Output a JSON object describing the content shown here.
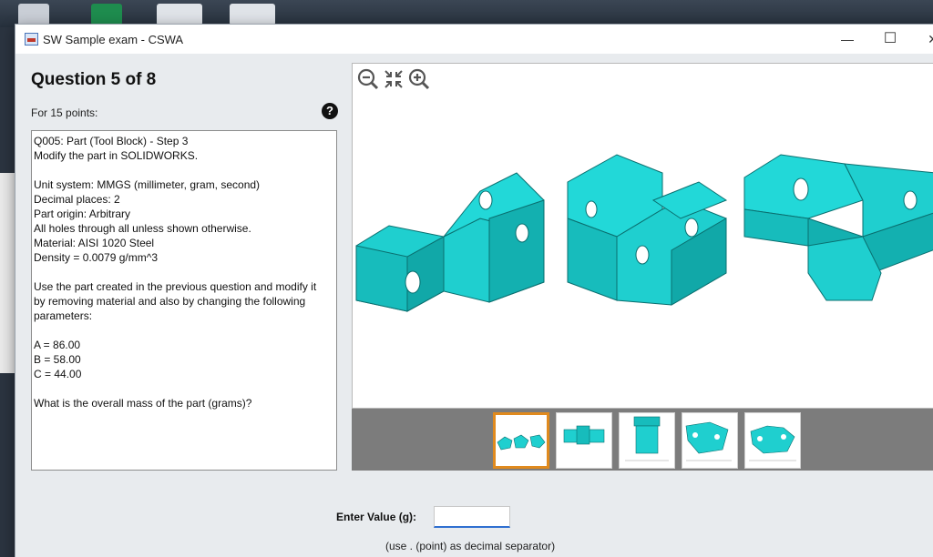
{
  "window": {
    "title": "SW Sample exam - CSWA",
    "controls": {
      "minimize": "—",
      "maximize": "☐",
      "close": "✕"
    }
  },
  "question": {
    "heading": "Question 5 of 8",
    "points": "For 15 points:",
    "help_icon": "question-circle-icon",
    "lines": [
      "Q005: Part (Tool Block) - Step 3",
      "Modify the part in SOLIDWORKS.",
      "",
      "Unit system: MMGS (millimeter, gram, second)",
      "Decimal places: 2",
      "Part origin: Arbitrary",
      "All holes through all unless shown otherwise.",
      "Material: AISI 1020 Steel",
      "Density = 0.0079 g/mm^3",
      "",
      "Use the part created in the previous question and modify it",
      "by removing material and also by changing the following",
      "parameters:",
      "",
      "A = 86.00",
      "B = 58.00",
      "C = 44.00",
      "",
      "What is the overall mass of the part (grams)?"
    ]
  },
  "viewer": {
    "tools": [
      "zoom-out-icon",
      "fit-to-window-icon",
      "zoom-in-icon"
    ],
    "model_color": "#1fcfcf",
    "thumbnails": [
      "isometric-views-thumbnail",
      "front-view-thumbnail",
      "side-view-thumbnail",
      "top-drawing-thumbnail",
      "dimension-drawing-thumbnail"
    ],
    "selected_thumbnail": 1
  },
  "answer": {
    "label": "Enter Value (g):",
    "value": "",
    "hint": "(use . (point) as decimal separator)"
  },
  "colors": {
    "accent": "#2f6fd0",
    "selection": "#e08a1e",
    "model": "#1fcfcf",
    "model_dark": "#11a8a8"
  }
}
